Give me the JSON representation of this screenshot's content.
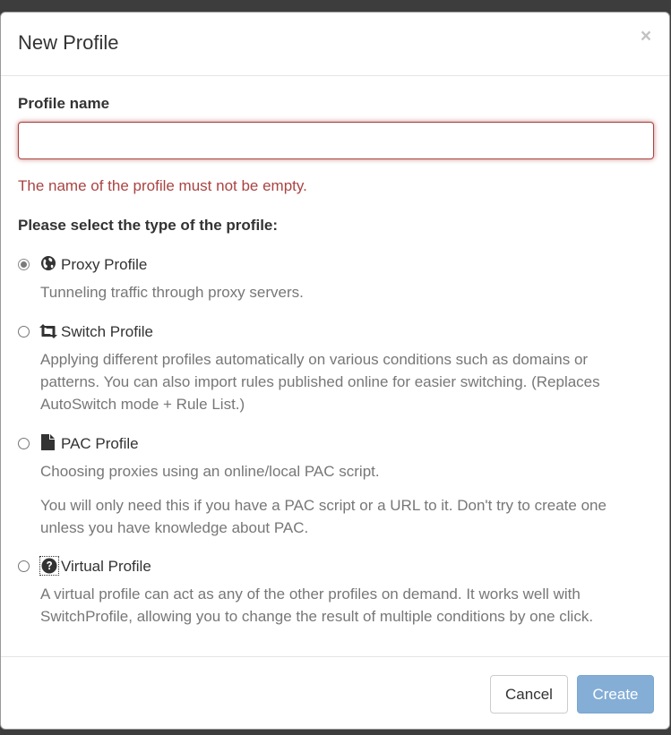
{
  "dialog": {
    "title": "New Profile",
    "close_glyph": "×"
  },
  "form": {
    "name_label": "Profile name",
    "name_value": "",
    "name_placeholder": "",
    "name_error": "The name of the profile must not be empty.",
    "type_heading": "Please select the type of the profile:"
  },
  "options": [
    {
      "title": "Proxy Profile",
      "icon": "globe-icon",
      "selected": true,
      "description": [
        "Tunneling traffic through proxy servers."
      ]
    },
    {
      "title": "Switch Profile",
      "icon": "retweet-icon",
      "selected": false,
      "description": [
        "Applying different profiles automatically on various conditions such as domains or patterns. You can also import rules published online for easier switching. (Replaces AutoSwitch mode + Rule List.)"
      ]
    },
    {
      "title": "PAC Profile",
      "icon": "file-icon",
      "selected": false,
      "description": [
        "Choosing proxies using an online/local PAC script.",
        "You will only need this if you have a PAC script or a URL to it. Don't try to create one unless you have knowledge about PAC."
      ]
    },
    {
      "title": "Virtual Profile",
      "icon": "question-sign-icon",
      "selected": false,
      "description": [
        "A virtual profile can act as any of the other profiles on demand. It works well with SwitchProfile, allowing you to change the result of multiple conditions by one click."
      ]
    }
  ],
  "footer": {
    "cancel_label": "Cancel",
    "create_label": "Create"
  },
  "colors": {
    "error": "#a94442",
    "muted": "#777777",
    "primary_disabled": "#84aed6"
  }
}
